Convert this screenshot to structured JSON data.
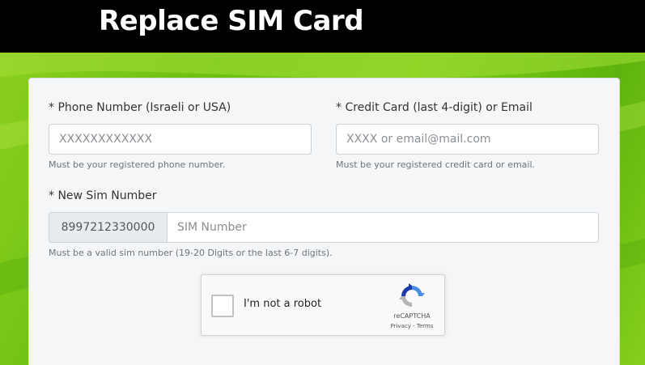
{
  "header": {
    "title": "Replace SIM Card"
  },
  "form": {
    "phone": {
      "label": "* Phone Number (Israeli or USA)",
      "placeholder": "XXXXXXXXXXXX",
      "help": "Must be your registered phone number."
    },
    "credit": {
      "label": "* Credit Card (last 4-digit) or Email",
      "placeholder": "XXXX or email@mail.com",
      "help": "Must be your registered credit card or email."
    },
    "sim": {
      "label": "* New Sim Number",
      "prefix": "8997212330000",
      "placeholder": "SIM Number",
      "help": "Must be a valid sim number (19-20 Digits or the last 6-7 digits)."
    }
  },
  "recaptcha": {
    "label": "I'm not a robot",
    "brand": "reCAPTCHA",
    "privacy": "Privacy",
    "separator": " - ",
    "terms": "Terms"
  },
  "colors": {
    "header_bg": "#000000",
    "background": "#7cc815",
    "card_bg": "#f4f6f8"
  }
}
